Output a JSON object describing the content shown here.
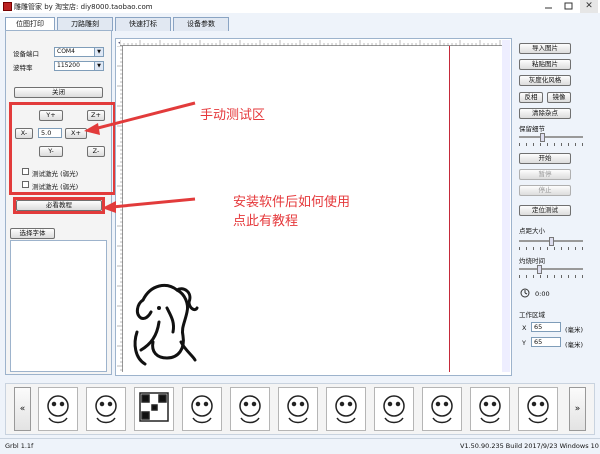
{
  "window": {
    "title": "雕雕管家 by 淘宝店: diy8000.taobao.com",
    "minimize_icon": "minimize-icon",
    "maximize_icon": "maximize-icon",
    "close_label": "✕"
  },
  "tabs": [
    {
      "label": "位图打印",
      "active": true
    },
    {
      "label": "刀路雕刻",
      "active": false
    },
    {
      "label": "快速打标",
      "active": false
    },
    {
      "label": "设备参数",
      "active": false
    }
  ],
  "left": {
    "port_label": "设备端口",
    "port_value": "COM4",
    "baud_label": "波特率",
    "baud_value": "115200",
    "close_button": "关闭",
    "y_plus": "Y+",
    "z_plus": "Z+",
    "x_minus": "X-",
    "step_value": "5.0",
    "x_plus": "X+",
    "y_minus": "Y-",
    "z_minus": "Z-",
    "laser_low": "测试激光 (弱光)",
    "laser_high": "测试激光 (弱光)",
    "tutorial_button": "必看教程",
    "font_button": "选择字体"
  },
  "annotations": {
    "manual_test": "手动测试区",
    "tutorial_line1": "安装软件后如何使用",
    "tutorial_line2": "点此有教程"
  },
  "right": {
    "import_image": "导入图片",
    "paste_image": "粘贴图片",
    "grayscale": "灰度化风格",
    "invert": "反相",
    "mirror": "镜像",
    "clear_noise": "清除杂点",
    "detail_label": "保留细节",
    "detail_level": 0.35,
    "start": "开始",
    "pause": "暂停",
    "stop": "停止",
    "position_test": "定位测试",
    "spot_size_label": "点距大小",
    "spot_size_level": 0.5,
    "burn_time_label": "灼烧时间",
    "burn_time_level": 0.3,
    "timer": "0:00",
    "work_area_label": "工作区域",
    "x_label": "X",
    "x_value": "65",
    "x_unit": "(毫米)",
    "y_label": "Y",
    "y_value": "65",
    "y_unit": "(毫米)"
  },
  "gallery": {
    "prev": "«",
    "next": "»",
    "items": [
      "duck-thumbnail",
      "horse-thumbnail",
      "qr-code-thumbnail",
      "bear-thumbnail",
      "girl-thumbnail",
      "bee-thumbnail",
      "sheep-thumbnail",
      "flower-thumbnail",
      "middle-finger-thumbnail",
      "fist-thumbnail",
      "cow-thumbnail"
    ]
  },
  "status": {
    "left": "Grbl 1.1f",
    "right": "V1.50.90.235 Build 2017/9/23 Windows 10"
  },
  "colors": {
    "annotation_red": "#e23b3b",
    "canvas_line": "#c52a3a"
  }
}
